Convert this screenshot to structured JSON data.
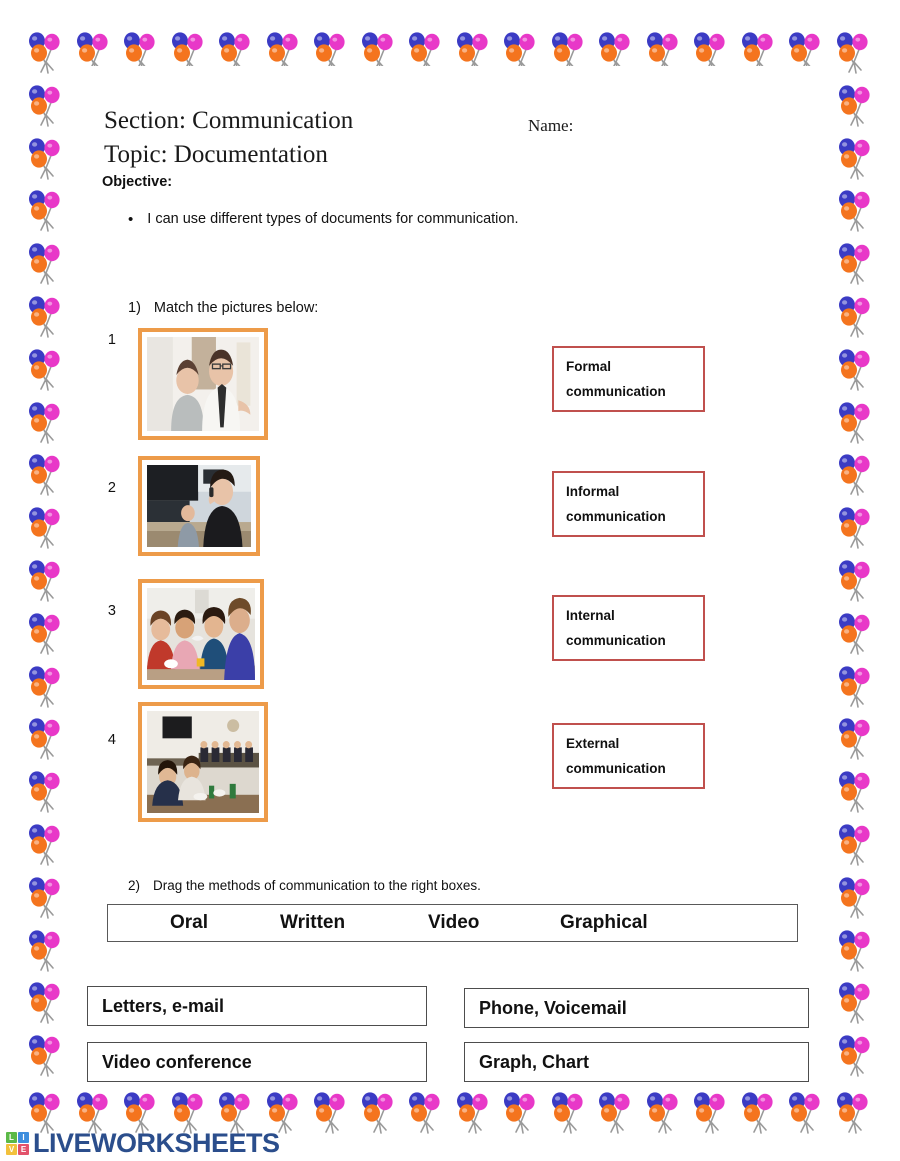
{
  "header": {
    "section_line": "Section: Communication",
    "topic_line": "Topic: Documentation",
    "name_label": "Name:",
    "objective_label": "Objective:",
    "objective_bullet": "I can use different types of documents for communication.",
    "bullet_glyph": "•"
  },
  "task1": {
    "number": "1)",
    "prompt": "Match the pictures below:",
    "picture_numbers": [
      "1",
      "2",
      "3",
      "4"
    ],
    "pictures": [
      {
        "number": "1",
        "alt": "two business colleagues talking in office"
      },
      {
        "number": "2",
        "alt": "woman on phone at office desk"
      },
      {
        "number": "3",
        "alt": "group of friends chatting at a table"
      },
      {
        "number": "4",
        "alt": "formal meeting in conference room"
      }
    ],
    "labels": [
      {
        "line1": "Formal",
        "line2": "communication"
      },
      {
        "line1": "Informal",
        "line2": "communication"
      },
      {
        "line1": "Internal",
        "line2": "communication"
      },
      {
        "line1": "External",
        "line2": "communication"
      }
    ]
  },
  "task2": {
    "number": "2)",
    "prompt": "Drag the methods of communication to the right boxes.",
    "word_bank": [
      "Oral",
      "Written",
      "Video",
      "Graphical"
    ],
    "drop_boxes": [
      "Letters, e-mail",
      "Phone, Voicemail",
      "Video conference",
      "Graph, Chart"
    ]
  },
  "footer": {
    "logo_text": "LIVEWORKSHEETS",
    "logo_tiles": [
      "L",
      "I",
      "V",
      "E"
    ]
  },
  "colors": {
    "photo_border": "#ED9B49",
    "label_border": "#C0504D",
    "box_border": "#4d4d4d",
    "logo_blue": "#2B4E8C",
    "balloon_blue": "#3B3BC4",
    "balloon_orange": "#F4741E",
    "balloon_magenta": "#E838C8"
  }
}
